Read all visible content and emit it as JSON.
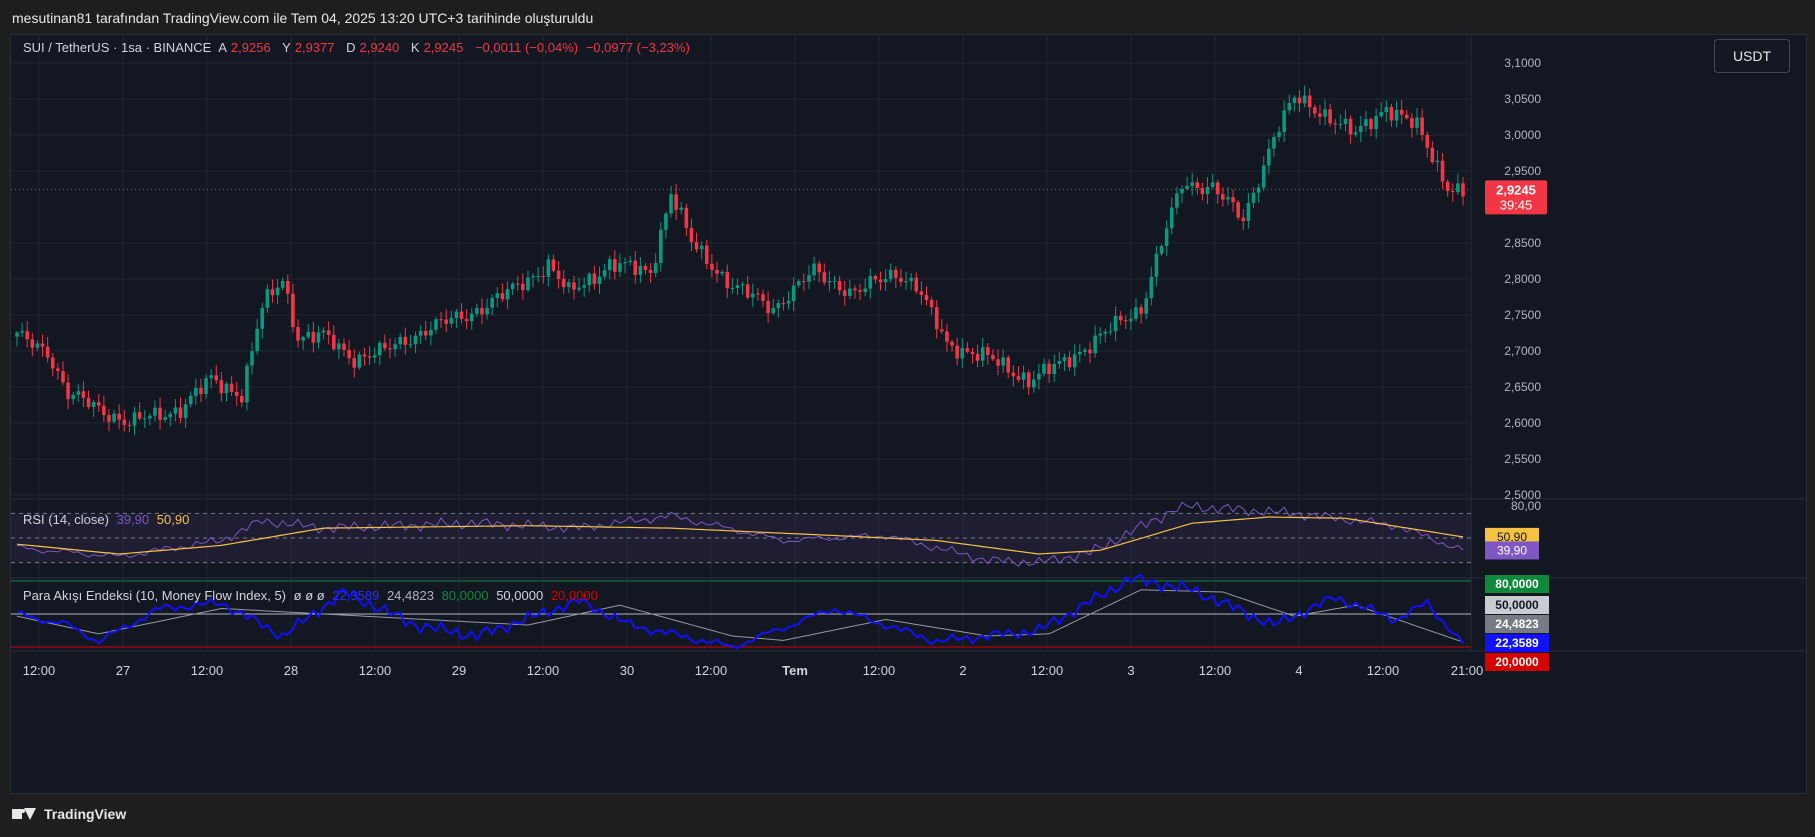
{
  "caption": "mesutinan81 tarafından TradingView.com ile Tem 04, 2025 13:20 UTC+3 tarihinde oluşturuldu",
  "footer_brand": "TradingView",
  "currency_button": "USDT",
  "price_legend": {
    "symbol": "SUI / TetherUS · 1sa · BINANCE",
    "open_label": "A",
    "open": "2,9256",
    "high_label": "Y",
    "high": "2,9377",
    "low_label": "D",
    "low": "2,9240",
    "close_label": "K",
    "close": "2,9245",
    "change": "−0,0011 (−0,04%)",
    "change2": "−0,0977 (−3,23%)"
  },
  "rsi_legend": {
    "name": "RSI (14, close)",
    "rsi": "39,90",
    "ma": "50,90"
  },
  "mfi_legend": {
    "name": "Para Akışı Endeksi (10, Money Flow Index, 5)",
    "flags": "ø ø ø",
    "v1": "22,3589",
    "v2": "24,4823",
    "v3": "80,0000",
    "v4": "50,0000",
    "v5": "20,0000"
  },
  "current_price": {
    "value": "2,9245",
    "countdown": "39:45"
  },
  "colors": {
    "bull": "#089981",
    "bear": "#f23645",
    "rsi": "#7e57c2",
    "rsi_ma": "#f5c242",
    "mfi": "#1010ff",
    "mfi_ma": "#9598a1",
    "mfi_upper": "#0c8a3a",
    "mfi_lower": "#d50000"
  },
  "chart_data": [
    {
      "type": "candlestick",
      "title": "SUI / TetherUS · 1sa · BINANCE",
      "ylim": [
        2.5,
        3.1
      ],
      "y_ticks": [
        "3,1000",
        "3,0500",
        "3,0000",
        "2,9500",
        "2,8500",
        "2,8000",
        "2,7500",
        "2,7000",
        "2,6500",
        "2,6000",
        "2,5500",
        "2,5000"
      ],
      "x_ticks": [
        "12:00",
        "27",
        "12:00",
        "28",
        "12:00",
        "29",
        "12:00",
        "30",
        "12:00",
        "Tem",
        "12:00",
        "2",
        "12:00",
        "3",
        "12:00",
        "4",
        "12:00",
        "21:00"
      ],
      "waypoints": [
        [
          0,
          2.72
        ],
        [
          6,
          2.7
        ],
        [
          10,
          2.64
        ],
        [
          16,
          2.62
        ],
        [
          22,
          2.6
        ],
        [
          32,
          2.62
        ],
        [
          38,
          2.66
        ],
        [
          44,
          2.64
        ],
        [
          48,
          2.76
        ],
        [
          52,
          2.8
        ],
        [
          55,
          2.72
        ],
        [
          60,
          2.72
        ],
        [
          66,
          2.69
        ],
        [
          72,
          2.7
        ],
        [
          80,
          2.73
        ],
        [
          88,
          2.75
        ],
        [
          96,
          2.78
        ],
        [
          104,
          2.82
        ],
        [
          108,
          2.78
        ],
        [
          116,
          2.82
        ],
        [
          124,
          2.81
        ],
        [
          128,
          2.92
        ],
        [
          132,
          2.85
        ],
        [
          140,
          2.79
        ],
        [
          148,
          2.76
        ],
        [
          156,
          2.81
        ],
        [
          164,
          2.78
        ],
        [
          172,
          2.81
        ],
        [
          176,
          2.79
        ],
        [
          182,
          2.71
        ],
        [
          190,
          2.69
        ],
        [
          198,
          2.66
        ],
        [
          204,
          2.68
        ],
        [
          212,
          2.72
        ],
        [
          220,
          2.76
        ],
        [
          224,
          2.85
        ],
        [
          228,
          2.93
        ],
        [
          234,
          2.93
        ],
        [
          240,
          2.88
        ],
        [
          246,
          3.0
        ],
        [
          250,
          3.05
        ],
        [
          256,
          3.03
        ],
        [
          262,
          3.0
        ],
        [
          268,
          3.04
        ],
        [
          274,
          3.01
        ],
        [
          280,
          2.93
        ],
        [
          283,
          2.92
        ]
      ]
    },
    {
      "type": "line",
      "title": "RSI (14, close)",
      "ylim": [
        20,
        80
      ],
      "y_ticks": [
        "80,00"
      ],
      "series": [
        {
          "name": "RSI",
          "waypoints": [
            [
              0,
              42
            ],
            [
              20,
              35
            ],
            [
              40,
              48
            ],
            [
              48,
              64
            ],
            [
              60,
              58
            ],
            [
              90,
              62
            ],
            [
              110,
              58
            ],
            [
              128,
              68
            ],
            [
              150,
              48
            ],
            [
              170,
              52
            ],
            [
              190,
              32
            ],
            [
              200,
              30
            ],
            [
              210,
              38
            ],
            [
              228,
              76
            ],
            [
              250,
              70
            ],
            [
              270,
              60
            ],
            [
              283,
              39.9
            ]
          ]
        },
        {
          "name": "MA",
          "waypoints": [
            [
              0,
              45
            ],
            [
              20,
              37
            ],
            [
              40,
              44
            ],
            [
              60,
              58
            ],
            [
              100,
              60
            ],
            [
              128,
              58
            ],
            [
              160,
              52
            ],
            [
              180,
              48
            ],
            [
              200,
              37
            ],
            [
              212,
              40
            ],
            [
              230,
              62
            ],
            [
              245,
              67
            ],
            [
              260,
              66
            ],
            [
              283,
              50.9
            ]
          ]
        }
      ],
      "bands": [
        70,
        50,
        30
      ]
    },
    {
      "type": "line",
      "title": "Para Akışı Endeksi (10, Money Flow Index, 5)",
      "ylim": [
        20,
        80
      ],
      "series": [
        {
          "name": "MFI",
          "waypoints": [
            [
              0,
              50
            ],
            [
              10,
              40
            ],
            [
              16,
              25
            ],
            [
              28,
              55
            ],
            [
              40,
              60
            ],
            [
              52,
              30
            ],
            [
              64,
              70
            ],
            [
              78,
              40
            ],
            [
              90,
              30
            ],
            [
              110,
              62
            ],
            [
              120,
              40
            ],
            [
              140,
              20
            ],
            [
              160,
              55
            ],
            [
              180,
              25
            ],
            [
              200,
              35
            ],
            [
              218,
              82
            ],
            [
              230,
              72
            ],
            [
              246,
              40
            ],
            [
              258,
              65
            ],
            [
              270,
              45
            ],
            [
              276,
              60
            ],
            [
              283,
              22.4
            ]
          ]
        },
        {
          "name": "MA",
          "waypoints": [
            [
              0,
              48
            ],
            [
              16,
              32
            ],
            [
              40,
              55
            ],
            [
              60,
              50
            ],
            [
              80,
              45
            ],
            [
              100,
              40
            ],
            [
              118,
              58
            ],
            [
              140,
              30
            ],
            [
              150,
              26
            ],
            [
              170,
              45
            ],
            [
              190,
              30
            ],
            [
              202,
              32
            ],
            [
              220,
              72
            ],
            [
              236,
              70
            ],
            [
              250,
              48
            ],
            [
              262,
              58
            ],
            [
              283,
              24.5
            ]
          ]
        }
      ],
      "levels": [
        80,
        50,
        20
      ]
    }
  ]
}
